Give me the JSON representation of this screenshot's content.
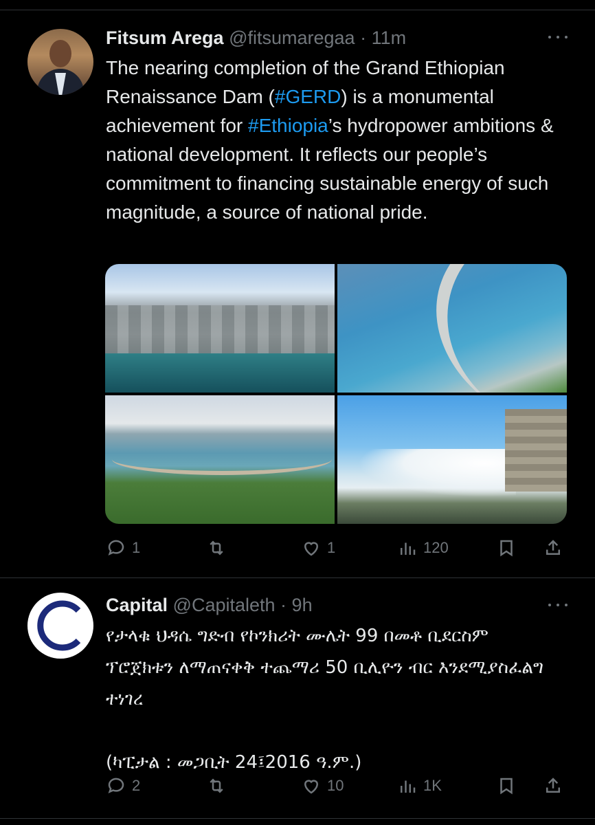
{
  "colors": {
    "background": "#000000",
    "text": "#e7e9ea",
    "muted": "#71767b",
    "link": "#1d9bf0",
    "divider": "#2f3336"
  },
  "tweets": [
    {
      "author_name": "Fitsum Arega",
      "handle": "@fitsumaregaa",
      "time": "11m",
      "text_parts": {
        "p1": "The nearing completion of the Grand Ethiopian Renaissance Dam (",
        "tag1": "#GERD",
        "p2": ") is a monumental achievement for ",
        "tag2": "#Ethiopia",
        "p3": "’s hydropower ambitions & national development. It reflects our people’s commitment to financing sustainable energy of such magnitude, a source of national pride."
      },
      "media_count": 4,
      "stats": {
        "replies": "1",
        "reposts": "",
        "likes": "1",
        "views": "120"
      },
      "icons": [
        "reply-icon",
        "repost-icon",
        "like-icon",
        "views-icon",
        "bookmark-icon",
        "share-icon"
      ]
    },
    {
      "author_name": "Capital",
      "handle": "@Capitaleth",
      "time": "9h",
      "text": "የታላቁ ህዳሴ ግድብ የኮንክሪት ሙሌት 99 በመቶ ቢደርስም ፕሮጀክቱን ለማጠናቀቅ ተጨማሪ 50 ቢሊዮን ብር እንደሚያስፈልግ ተነገረ\n\n(ካፒታል : መጋቢት 24፤2016 ዓ.ም.)",
      "stats": {
        "replies": "2",
        "reposts": "",
        "likes": "10",
        "views": "1K"
      },
      "icons": [
        "reply-icon",
        "repost-icon",
        "like-icon",
        "views-icon",
        "bookmark-icon",
        "share-icon"
      ]
    }
  ]
}
